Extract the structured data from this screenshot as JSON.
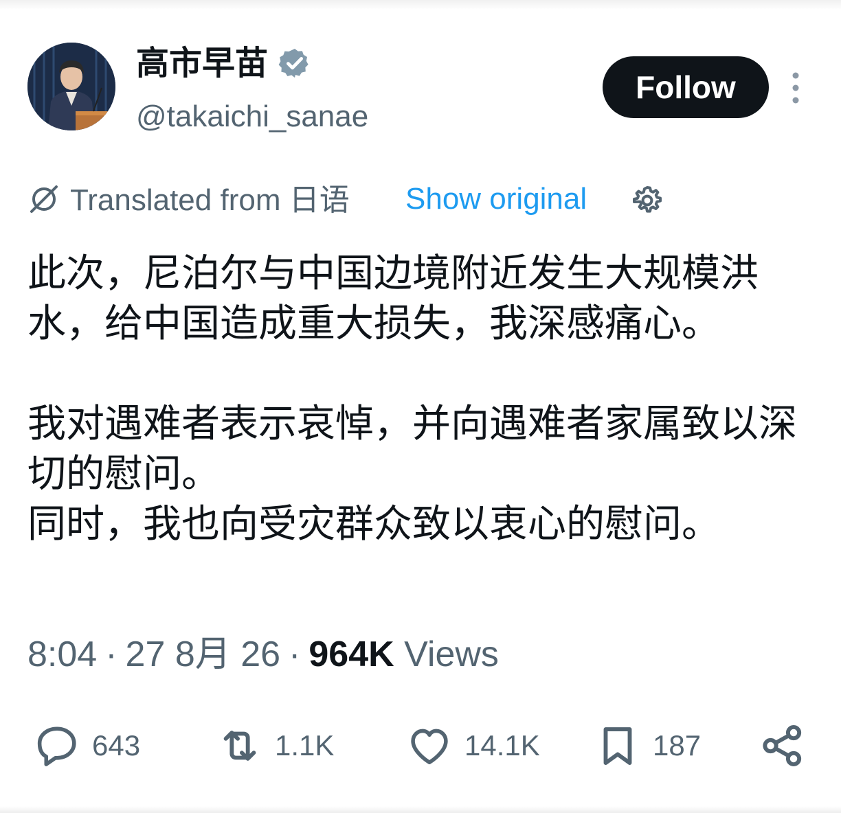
{
  "author": {
    "display_name": "高市早苗",
    "handle": "@takaichi_sanae",
    "verified": true,
    "verified_color": "#829aab"
  },
  "follow_label": "Follow",
  "translation": {
    "translated_from": "Translated from 日语",
    "show_original": "Show original"
  },
  "post": {
    "paragraph1": "此次，尼泊尔与中国边境附近发生大规模洪水，给中国造成重大损失，我深感痛心。",
    "paragraph2": "我对遇难者表示哀悼，并向遇难者家属致以深切的慰问。",
    "paragraph3": "同时，我也向受灾群众致以衷心的慰问。"
  },
  "meta": {
    "time": "8:04",
    "date": "27 8月 26",
    "views_count": "964K",
    "views_label": "Views"
  },
  "actions": {
    "replies": "643",
    "reposts": "1.1K",
    "likes": "14.1K",
    "bookmarks": "187"
  },
  "colors": {
    "primary_text": "#0f1419",
    "secondary_text": "#536471",
    "link": "#1d9bf0",
    "follow_bg": "#0f1419"
  },
  "icons": [
    "verified-badge-icon",
    "more-icon",
    "translate-icon",
    "settings-icon",
    "reply-icon",
    "repost-icon",
    "like-icon",
    "bookmark-icon",
    "share-icon"
  ]
}
